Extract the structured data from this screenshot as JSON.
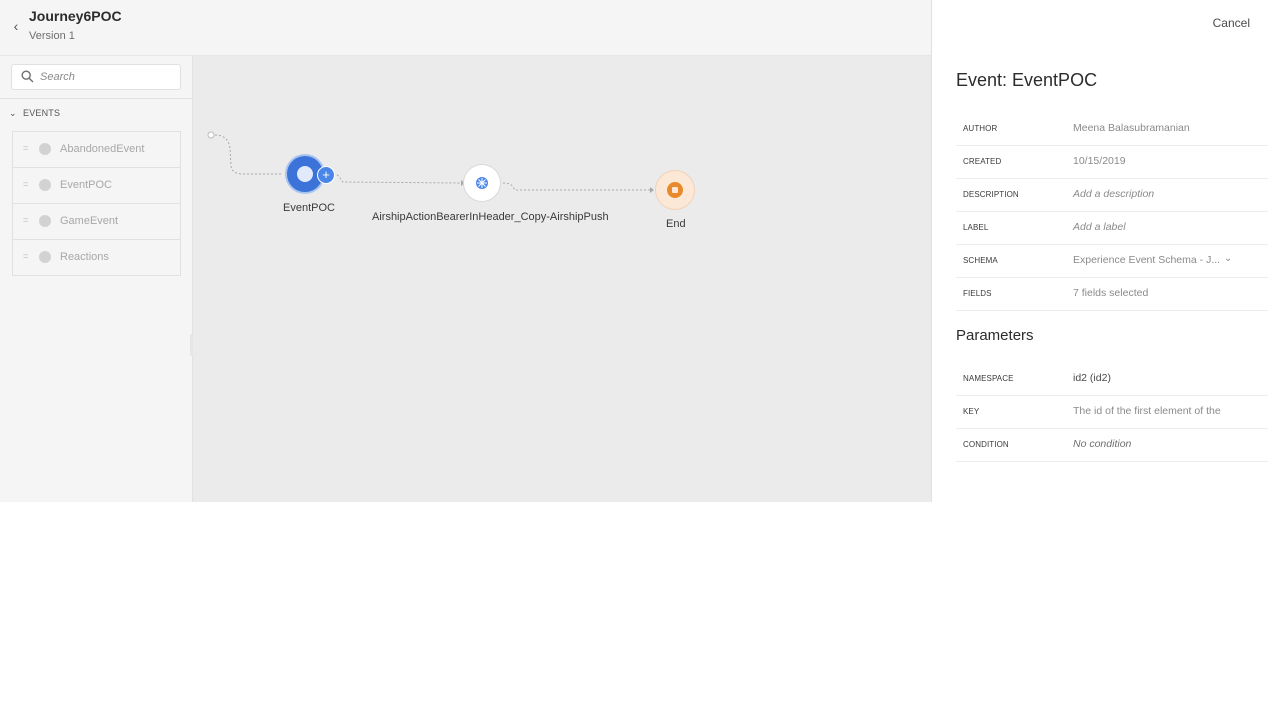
{
  "header": {
    "title": "Journey6POC",
    "version": "Version 1"
  },
  "sidebar": {
    "search_placeholder": "Search",
    "section_label": "EVENTS",
    "events": [
      {
        "label": "AbandonedEvent"
      },
      {
        "label": "EventPOC"
      },
      {
        "label": "GameEvent"
      },
      {
        "label": "Reactions"
      }
    ]
  },
  "canvas": {
    "nodes": {
      "event_label": "EventPOC",
      "action_label": "AirshipActionBearerInHeader_Copy-AirshipPush",
      "end_label": "End"
    }
  },
  "panel": {
    "cancel_label": "Cancel",
    "title": "Event: EventPOC",
    "properties": {
      "author_key": "AUTHOR",
      "author_value": "Meena Balasubramanian",
      "created_key": "CREATED",
      "created_value": "10/15/2019",
      "description_key": "DESCRIPTION",
      "description_placeholder": "Add a description",
      "label_key": "LABEL",
      "label_placeholder": "Add a label",
      "schema_key": "SCHEMA",
      "schema_value": "Experience Event Schema - J...",
      "fields_key": "FIELDS",
      "fields_value": "7 fields selected"
    },
    "parameters_title": "Parameters",
    "parameters": {
      "namespace_key": "NAMESPACE",
      "namespace_value": "id2 (id2)",
      "key_key": "KEY",
      "key_value": "The id of the first element of the",
      "condition_key": "CONDITION",
      "condition_value": "No condition"
    }
  },
  "colors": {
    "event_node": "#3b73d9",
    "end_node": "#e8892b",
    "action_icon": "#4a86e8",
    "canvas_bg": "#ebebeb"
  },
  "icons": {
    "back": "chevron-left-icon",
    "search": "search-icon",
    "section_toggle": "chevron-down-icon",
    "event_item": "globe-icon",
    "add": "plus-icon",
    "action": "airship-icon",
    "end": "stop-icon"
  }
}
